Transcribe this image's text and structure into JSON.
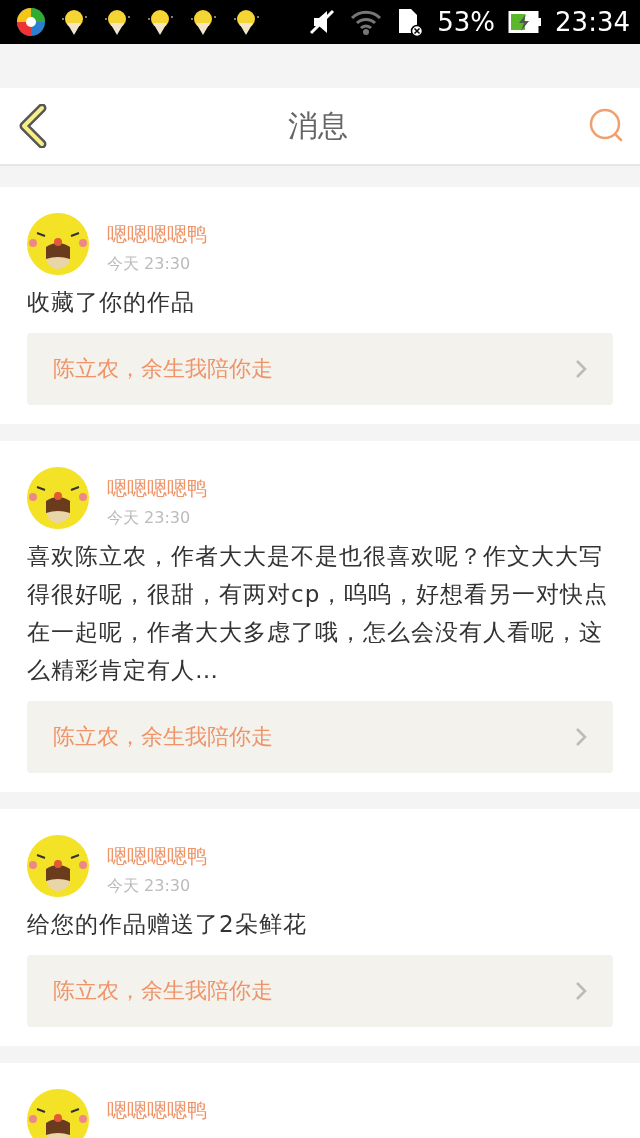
{
  "status_bar": {
    "battery": "53%",
    "time": "23:34"
  },
  "header": {
    "title": "消息"
  },
  "messages": [
    {
      "user": "嗯嗯嗯嗯鸭",
      "time": "今天 23:30",
      "text": "收藏了你的作品",
      "work": "陈立农，余生我陪你走"
    },
    {
      "user": "嗯嗯嗯嗯鸭",
      "time": "今天 23:30",
      "text": "喜欢陈立农，作者大大是不是也很喜欢呢？作文大大写得很好呢，很甜，有两对cp，呜呜，好想看另一对快点在一起呢，作者大大多虑了哦，怎么会没有人看呢，这么精彩肯定有人…",
      "work": "陈立农，余生我陪你走"
    },
    {
      "user": "嗯嗯嗯嗯鸭",
      "time": "今天 23:30",
      "text": "给您的作品赠送了2朵鲜花",
      "work": "陈立农，余生我陪你走"
    },
    {
      "user": "嗯嗯嗯嗯鸭"
    }
  ]
}
